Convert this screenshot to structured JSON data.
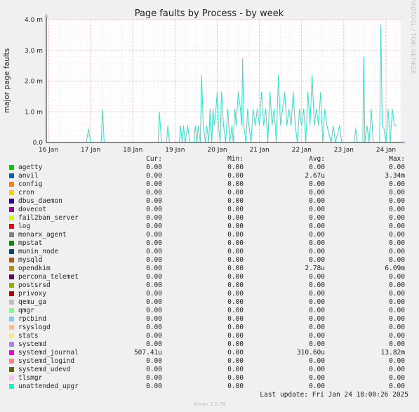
{
  "chart_data": {
    "type": "line",
    "title": "Page faults by Process - by week",
    "ylabel": "major page faults",
    "side_label": "RRDTOOL / TOBI OETIKER",
    "ylim": [
      0,
      4.0
    ],
    "y_ticks": [
      "0.0",
      "1.0 m",
      "2.0 m",
      "3.0 m",
      "4.0 m"
    ],
    "x_ticks": [
      "16 Jan",
      "17 Jan",
      "18 Jan",
      "19 Jan",
      "20 Jan",
      "21 Jan",
      "22 Jan",
      "23 Jan",
      "24 Jan"
    ],
    "x_range_days": [
      15.95,
      24.35
    ],
    "grid": true,
    "series": [
      {
        "name": "systemd_journal",
        "color": "#33e0c7",
        "points": [
          [
            16.0,
            0
          ],
          [
            16.9,
            0
          ],
          [
            16.95,
            0.45
          ],
          [
            17.0,
            0
          ],
          [
            17.25,
            0
          ],
          [
            17.28,
            1.1
          ],
          [
            17.32,
            0
          ],
          [
            18.6,
            0
          ],
          [
            18.63,
            1.0
          ],
          [
            18.68,
            0
          ],
          [
            18.8,
            0
          ],
          [
            18.83,
            0.55
          ],
          [
            18.87,
            0
          ],
          [
            19.1,
            0
          ],
          [
            19.13,
            0.55
          ],
          [
            19.17,
            0
          ],
          [
            19.2,
            0.55
          ],
          [
            19.24,
            0
          ],
          [
            19.3,
            0.55
          ],
          [
            19.35,
            0
          ],
          [
            19.45,
            0
          ],
          [
            19.48,
            0.55
          ],
          [
            19.52,
            0
          ],
          [
            19.55,
            0.55
          ],
          [
            19.6,
            0
          ],
          [
            19.63,
            2.2
          ],
          [
            19.67,
            0.55
          ],
          [
            19.72,
            0
          ],
          [
            19.75,
            0.55
          ],
          [
            19.8,
            0
          ],
          [
            19.83,
            1.1
          ],
          [
            19.87,
            0
          ],
          [
            19.9,
            1.1
          ],
          [
            19.93,
            0.55
          ],
          [
            19.97,
            1.1
          ],
          [
            20.0,
            1.65
          ],
          [
            20.03,
            0.55
          ],
          [
            20.07,
            0
          ],
          [
            20.1,
            1.65
          ],
          [
            20.15,
            0.55
          ],
          [
            20.2,
            0
          ],
          [
            20.25,
            1.1
          ],
          [
            20.3,
            0
          ],
          [
            20.35,
            0.55
          ],
          [
            20.38,
            0
          ],
          [
            20.42,
            1.1
          ],
          [
            20.45,
            0.55
          ],
          [
            20.5,
            1.65
          ],
          [
            20.55,
            1.1
          ],
          [
            20.58,
            0.55
          ],
          [
            20.6,
            2.75
          ],
          [
            20.63,
            0.55
          ],
          [
            20.68,
            0
          ],
          [
            20.72,
            1.1
          ],
          [
            20.75,
            0.55
          ],
          [
            20.8,
            0
          ],
          [
            20.85,
            1.1
          ],
          [
            20.9,
            0.55
          ],
          [
            20.95,
            1.1
          ],
          [
            21.0,
            0.55
          ],
          [
            21.05,
            1.65
          ],
          [
            21.1,
            0.55
          ],
          [
            21.15,
            1.1
          ],
          [
            21.2,
            0
          ],
          [
            21.25,
            1.65
          ],
          [
            21.3,
            0.55
          ],
          [
            21.35,
            1.1
          ],
          [
            21.4,
            0
          ],
          [
            21.45,
            2.2
          ],
          [
            21.5,
            0.55
          ],
          [
            21.55,
            1.1
          ],
          [
            21.6,
            1.65
          ],
          [
            21.65,
            0.55
          ],
          [
            21.7,
            1.1
          ],
          [
            21.75,
            0.55
          ],
          [
            21.8,
            1.65
          ],
          [
            21.85,
            0.55
          ],
          [
            21.9,
            0
          ],
          [
            21.95,
            1.1
          ],
          [
            22.0,
            0.55
          ],
          [
            22.05,
            1.1
          ],
          [
            22.1,
            0
          ],
          [
            22.15,
            1.65
          ],
          [
            22.2,
            0.55
          ],
          [
            22.25,
            2.2
          ],
          [
            22.3,
            0.55
          ],
          [
            22.35,
            1.1
          ],
          [
            22.4,
            0.55
          ],
          [
            22.45,
            1.65
          ],
          [
            22.5,
            0
          ],
          [
            22.55,
            1.1
          ],
          [
            22.6,
            0.55
          ],
          [
            22.7,
            0
          ],
          [
            22.75,
            0.55
          ],
          [
            22.8,
            0
          ],
          [
            22.9,
            0.55
          ],
          [
            22.95,
            0
          ],
          [
            23.25,
            0
          ],
          [
            23.28,
            0.45
          ],
          [
            23.32,
            0
          ],
          [
            23.45,
            0
          ],
          [
            23.47,
            2.8
          ],
          [
            23.5,
            0
          ],
          [
            23.55,
            0.55
          ],
          [
            23.6,
            0
          ],
          [
            23.65,
            1.1
          ],
          [
            23.7,
            0
          ],
          [
            23.85,
            0
          ],
          [
            23.88,
            3.85
          ],
          [
            23.91,
            0.55
          ],
          [
            23.95,
            0.45
          ],
          [
            24.0,
            0
          ],
          [
            24.05,
            1.1
          ],
          [
            24.1,
            0
          ],
          [
            24.15,
            1.1
          ],
          [
            24.2,
            0.55
          ],
          [
            24.25,
            0.55
          ]
        ]
      }
    ]
  },
  "legend": {
    "headers": {
      "cur": "Cur:",
      "min": "Min:",
      "avg": "Avg:",
      "max": "Max:"
    },
    "rows": [
      {
        "name": "agetty",
        "color": "#00cc00",
        "cur": "0.00",
        "min": "0.00",
        "avg": "0.00",
        "max": "0.00"
      },
      {
        "name": "anvil",
        "color": "#0066b3",
        "cur": "0.00",
        "min": "0.00",
        "avg": "2.67u",
        "max": "3.34m"
      },
      {
        "name": "config",
        "color": "#ff8000",
        "cur": "0.00",
        "min": "0.00",
        "avg": "0.00",
        "max": "0.00"
      },
      {
        "name": "cron",
        "color": "#ffcc00",
        "cur": "0.00",
        "min": "0.00",
        "avg": "0.00",
        "max": "0.00"
      },
      {
        "name": "dbus_daemon",
        "color": "#330099",
        "cur": "0.00",
        "min": "0.00",
        "avg": "0.00",
        "max": "0.00"
      },
      {
        "name": "dovecot",
        "color": "#990099",
        "cur": "0.00",
        "min": "0.00",
        "avg": "0.00",
        "max": "0.00"
      },
      {
        "name": "fail2ban_server",
        "color": "#ccff00",
        "cur": "0.00",
        "min": "0.00",
        "avg": "0.00",
        "max": "0.00"
      },
      {
        "name": "log",
        "color": "#ff0000",
        "cur": "0.00",
        "min": "0.00",
        "avg": "0.00",
        "max": "0.00"
      },
      {
        "name": "monarx_agent",
        "color": "#808080",
        "cur": "0.00",
        "min": "0.00",
        "avg": "0.00",
        "max": "0.00"
      },
      {
        "name": "mpstat",
        "color": "#008f00",
        "cur": "0.00",
        "min": "0.00",
        "avg": "0.00",
        "max": "0.00"
      },
      {
        "name": "munin_node",
        "color": "#00487d",
        "cur": "0.00",
        "min": "0.00",
        "avg": "0.00",
        "max": "0.00"
      },
      {
        "name": "mysqld",
        "color": "#b35a00",
        "cur": "0.00",
        "min": "0.00",
        "avg": "0.00",
        "max": "0.00"
      },
      {
        "name": "opendkim",
        "color": "#b38f00",
        "cur": "0.00",
        "min": "0.00",
        "avg": "2.78u",
        "max": "6.09m"
      },
      {
        "name": "percona_telemet",
        "color": "#6b006b",
        "cur": "0.00",
        "min": "0.00",
        "avg": "0.00",
        "max": "0.00"
      },
      {
        "name": "postsrsd",
        "color": "#8fb300",
        "cur": "0.00",
        "min": "0.00",
        "avg": "0.00",
        "max": "0.00"
      },
      {
        "name": "privoxy",
        "color": "#b30000",
        "cur": "0.00",
        "min": "0.00",
        "avg": "0.00",
        "max": "0.00"
      },
      {
        "name": "qemu_ga",
        "color": "#bebebe",
        "cur": "0.00",
        "min": "0.00",
        "avg": "0.00",
        "max": "0.00"
      },
      {
        "name": "qmgr",
        "color": "#80ff80",
        "cur": "0.00",
        "min": "0.00",
        "avg": "0.00",
        "max": "0.00"
      },
      {
        "name": "rpcbind",
        "color": "#80c9ff",
        "cur": "0.00",
        "min": "0.00",
        "avg": "0.00",
        "max": "0.00"
      },
      {
        "name": "rsyslogd",
        "color": "#ffc080",
        "cur": "0.00",
        "min": "0.00",
        "avg": "0.00",
        "max": "0.00"
      },
      {
        "name": "stats",
        "color": "#ffe680",
        "cur": "0.00",
        "min": "0.00",
        "avg": "0.00",
        "max": "0.00"
      },
      {
        "name": "systemd",
        "color": "#aa80ff",
        "cur": "0.00",
        "min": "0.00",
        "avg": "0.00",
        "max": "0.00"
      },
      {
        "name": "systemd_journal",
        "color": "#ee00cc",
        "cur": "507.41u",
        "min": "0.00",
        "avg": "310.60u",
        "max": "13.82m"
      },
      {
        "name": "systemd_logind",
        "color": "#ff8080",
        "cur": "0.00",
        "min": "0.00",
        "avg": "0.00",
        "max": "0.00"
      },
      {
        "name": "systemd_udevd",
        "color": "#666600",
        "cur": "0.00",
        "min": "0.00",
        "avg": "0.00",
        "max": "0.00"
      },
      {
        "name": "tlsmgr",
        "color": "#ffbfff",
        "cur": "0.00",
        "min": "0.00",
        "avg": "0.00",
        "max": "0.00"
      },
      {
        "name": "unattended_upgr",
        "color": "#00ffcc",
        "cur": "0.00",
        "min": "0.00",
        "avg": "0.00",
        "max": "0.00"
      }
    ]
  },
  "footer": {
    "last_update": "Last update: Fri Jan 24 18:00:26 2025",
    "version": "Munin 2.0.76"
  }
}
